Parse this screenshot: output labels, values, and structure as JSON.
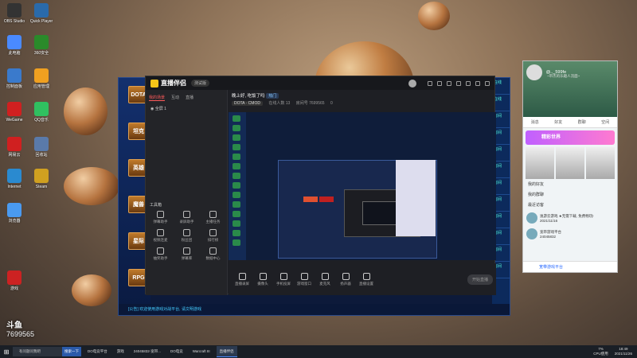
{
  "desktop": {
    "icons": [
      {
        "label": "OBS Studio",
        "color": "#333"
      },
      {
        "label": "Quick Player",
        "color": "#2a6aaa"
      },
      {
        "label": "此电脑",
        "color": "#4a8aff"
      },
      {
        "label": "360安全",
        "color": "#2a8a2a"
      },
      {
        "label": "控制面板",
        "color": "#3a7acc"
      },
      {
        "label": "应用管理",
        "color": "#f0a020"
      },
      {
        "label": "WeGame",
        "color": "#d02020"
      },
      {
        "label": "QQ音乐",
        "color": "#30c060"
      },
      {
        "label": "网易云",
        "color": "#d02020"
      },
      {
        "label": "回收站",
        "color": "#5a7aaa"
      },
      {
        "label": "Internet",
        "color": "#2a8ad0"
      },
      {
        "label": "Steam",
        "color": "#d0a020"
      },
      {
        "label": "浏览器",
        "color": "#4a9af0"
      },
      {
        "label": "游戏",
        "color": "#cc2222"
      }
    ],
    "watermark_title": "斗鱼",
    "watermark_id": "7699565"
  },
  "launcher": {
    "tiles": [
      "DOTA",
      "坦克",
      "英雄",
      "魔兽",
      "星际",
      "RPG"
    ],
    "right_labels": [
      "在线",
      "在线",
      "房间",
      "房间",
      "房间",
      "房间",
      "房间",
      "房间",
      "房间",
      "房间",
      "房间",
      "房间"
    ],
    "status_text": "[公告] 欢迎使用游戏对战平台, 请文明游戏"
  },
  "app": {
    "title": "直播伴侣",
    "badge": "测试版",
    "tabs": [
      "我的场景",
      "互动",
      "直播"
    ],
    "scene": "全屏 1",
    "tools_title": "工具箱",
    "tools": [
      "弹幕助手",
      "录屏助手",
      "主播任务",
      "视频连麦",
      "粉丝团",
      "排行榜",
      "抽奖助手",
      "弹幕库",
      "数据中心"
    ],
    "stream_title": "晚上好, 吃饭了吗",
    "tag_hot": "热门",
    "tag_game": "DOTA",
    "tag_mode": "DOTA · CMOD",
    "viewers": "在线人数 13",
    "room": "房间号 7699565",
    "likes": "0",
    "bottom_buttons": [
      "直播录屏",
      "摄像头",
      "手机投屏",
      "游戏窗口",
      "麦克风",
      "扬声器",
      "直播设置"
    ],
    "start_live": "开始直播"
  },
  "chat": {
    "name": "@.._599fe",
    "sign": "~带杰的乐趣人流面~",
    "tabs": [
      "消息",
      "好友",
      "群聊",
      "空间"
    ],
    "promo": "精彩世界",
    "list": [
      "我的好友",
      "我的群聊",
      "最近访客"
    ],
    "contacts": [
      {
        "name": "逸游云游戏 ★无需下载, 免费畅玩!",
        "time": "2021/11/16"
      },
      {
        "name": "宽带游戏平台",
        "time": "24045832"
      }
    ],
    "bottom": "宽带游戏平台"
  },
  "taskbar": {
    "search_placeholder": "有问题问我吧",
    "search_button": "搜索一下",
    "tasks": [
      "DO电竞平台",
      "游戏",
      "24045832-宽带...",
      "DO电竞",
      "Warcraft III",
      "直播伴侣"
    ],
    "cpu": "7%",
    "cpu_label": "CPU使用",
    "time": "18:49",
    "date": "2021/11/26"
  }
}
